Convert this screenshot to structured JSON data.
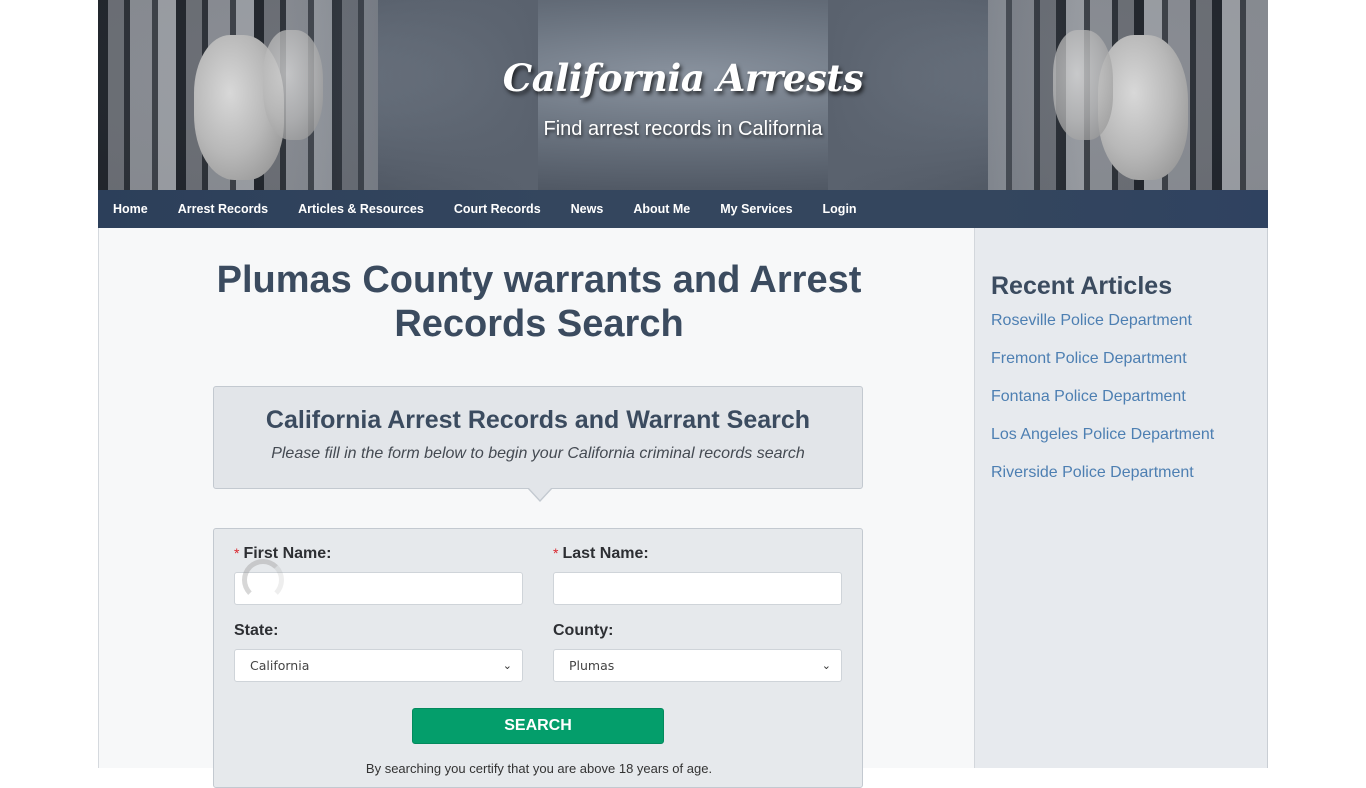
{
  "header": {
    "site_title": "California Arrests",
    "tagline": "Find arrest records in California"
  },
  "nav": {
    "items": [
      {
        "label": "Home"
      },
      {
        "label": "Arrest Records"
      },
      {
        "label": "Articles & Resources"
      },
      {
        "label": "Court Records"
      },
      {
        "label": "News"
      },
      {
        "label": "About Me"
      },
      {
        "label": "My Services"
      },
      {
        "label": "Login"
      }
    ]
  },
  "main": {
    "page_title": "Plumas County warrants and Arrest Records Search",
    "callout": {
      "heading": "California Arrest Records and Warrant Search",
      "subheading": "Please fill in the form below to begin your California criminal records search"
    },
    "form": {
      "required_marker": "*",
      "first_name": {
        "label": "First Name:",
        "value": ""
      },
      "last_name": {
        "label": "Last Name:",
        "value": ""
      },
      "state": {
        "label": "State:",
        "selected": "California"
      },
      "county": {
        "label": "County:",
        "selected": "Plumas"
      },
      "chevron": "⌄",
      "search_label": "SEARCH",
      "disclaimer": "By searching you certify that you are above 18 years of age."
    }
  },
  "sidebar": {
    "heading": "Recent Articles",
    "articles": [
      {
        "label": "Roseville Police Department"
      },
      {
        "label": "Fremont Police Department"
      },
      {
        "label": "Fontana Police Department"
      },
      {
        "label": "Los Angeles Police Department"
      },
      {
        "label": "Riverside Police Department"
      }
    ]
  },
  "colors": {
    "nav_bg": "#34465e",
    "heading": "#3b4b5f",
    "link": "#4d7fb2",
    "search_button": "#049e6b",
    "required": "#d9262e"
  }
}
